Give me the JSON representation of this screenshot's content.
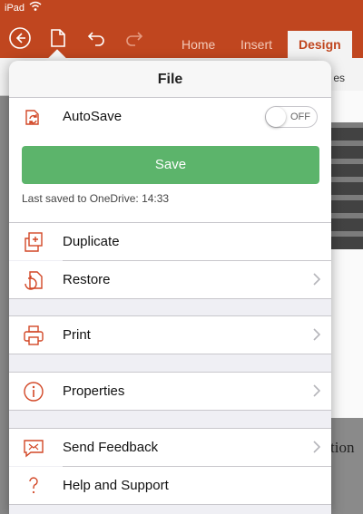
{
  "status": {
    "carrier": "iPad"
  },
  "toolbar": {
    "tabs": [
      {
        "label": "Home",
        "active": false
      },
      {
        "label": "Insert",
        "active": false
      },
      {
        "label": "Design",
        "active": true
      }
    ]
  },
  "background": {
    "ribbon_text": "es",
    "doc_fragment": "tion"
  },
  "file_menu": {
    "title": "File",
    "autosave": {
      "label": "AutoSave",
      "toggle_state": "OFF"
    },
    "save": {
      "label": "Save",
      "last_saved": "Last saved to OneDrive: 14:33"
    },
    "items": [
      {
        "label": "Duplicate",
        "icon": "duplicate-icon",
        "chevron": false
      },
      {
        "label": "Restore",
        "icon": "restore-icon",
        "chevron": true
      },
      {
        "label": "Print",
        "icon": "print-icon",
        "chevron": true
      },
      {
        "label": "Properties",
        "icon": "info-icon",
        "chevron": true
      },
      {
        "label": "Send Feedback",
        "icon": "feedback-icon",
        "chevron": true
      },
      {
        "label": "Help and Support",
        "icon": "help-icon",
        "chevron": false
      }
    ]
  },
  "colors": {
    "accent": "#c0461f",
    "save_green": "#5cb46b",
    "icon_orange": "#d24726"
  }
}
